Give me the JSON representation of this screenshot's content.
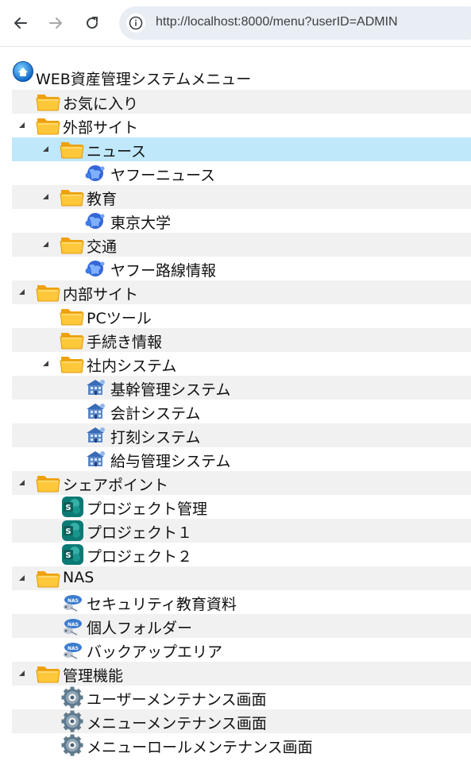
{
  "browser": {
    "url": "http://localhost:8000/menu?userID=ADMIN"
  },
  "tree": {
    "root_label": "WEB資産管理システムメニュー",
    "items": [
      {
        "label": "お気に入り",
        "icon": "folder-icon",
        "level": 1,
        "expandable": false,
        "stripe": true
      },
      {
        "label": "外部サイト",
        "icon": "folder-icon",
        "level": 1,
        "expandable": true,
        "stripe": false
      },
      {
        "label": "ニュース",
        "icon": "folder-icon",
        "level": 2,
        "expandable": true,
        "stripe": false,
        "selected": true
      },
      {
        "label": "ヤフーニュース",
        "icon": "web-globe-icon",
        "level": 3,
        "expandable": false,
        "stripe": false
      },
      {
        "label": "教育",
        "icon": "folder-icon",
        "level": 2,
        "expandable": true,
        "stripe": true
      },
      {
        "label": "東京大学",
        "icon": "web-globe-icon",
        "level": 3,
        "expandable": false,
        "stripe": false
      },
      {
        "label": "交通",
        "icon": "folder-icon",
        "level": 2,
        "expandable": true,
        "stripe": true
      },
      {
        "label": "ヤフー路線情報",
        "icon": "web-globe-icon",
        "level": 3,
        "expandable": false,
        "stripe": false
      },
      {
        "label": "内部サイト",
        "icon": "folder-icon",
        "level": 1,
        "expandable": true,
        "stripe": true
      },
      {
        "label": "PCツール",
        "icon": "folder-icon",
        "level": 2,
        "expandable": false,
        "stripe": false
      },
      {
        "label": "手続き情報",
        "icon": "folder-icon",
        "level": 2,
        "expandable": false,
        "stripe": true
      },
      {
        "label": "社内システム",
        "icon": "folder-icon",
        "level": 2,
        "expandable": true,
        "stripe": false
      },
      {
        "label": "基幹管理システム",
        "icon": "internal-system-icon",
        "level": 3,
        "expandable": false,
        "stripe": true
      },
      {
        "label": "会計システム",
        "icon": "internal-system-icon",
        "level": 3,
        "expandable": false,
        "stripe": false
      },
      {
        "label": "打刻システム",
        "icon": "internal-system-icon",
        "level": 3,
        "expandable": false,
        "stripe": true
      },
      {
        "label": "給与管理システム",
        "icon": "internal-system-icon",
        "level": 3,
        "expandable": false,
        "stripe": false
      },
      {
        "label": "シェアポイント",
        "icon": "folder-icon",
        "level": 1,
        "expandable": true,
        "stripe": true
      },
      {
        "label": "プロジェクト管理",
        "icon": "sharepoint-icon",
        "level": 2,
        "expandable": false,
        "stripe": false
      },
      {
        "label": "プロジェクト１",
        "icon": "sharepoint-icon",
        "level": 2,
        "expandable": false,
        "stripe": true
      },
      {
        "label": "プロジェクト２",
        "icon": "sharepoint-icon",
        "level": 2,
        "expandable": false,
        "stripe": false
      },
      {
        "label": "NAS",
        "icon": "folder-icon",
        "level": 1,
        "expandable": true,
        "stripe": true
      },
      {
        "label": "セキュリティ教育資料",
        "icon": "nas-icon",
        "level": 2,
        "expandable": false,
        "stripe": false
      },
      {
        "label": "個人フォルダー",
        "icon": "nas-icon",
        "level": 2,
        "expandable": false,
        "stripe": true
      },
      {
        "label": "バックアップエリア",
        "icon": "nas-icon",
        "level": 2,
        "expandable": false,
        "stripe": false
      },
      {
        "label": "管理機能",
        "icon": "folder-icon",
        "level": 1,
        "expandable": true,
        "stripe": true
      },
      {
        "label": "ユーザーメンテナンス画面",
        "icon": "gear-icon",
        "level": 2,
        "expandable": false,
        "stripe": false
      },
      {
        "label": "メニューメンテナンス画面",
        "icon": "gear-icon",
        "level": 2,
        "expandable": false,
        "stripe": true
      },
      {
        "label": "メニューロールメンテナンス画面",
        "icon": "gear-icon",
        "level": 2,
        "expandable": false,
        "stripe": false
      }
    ]
  },
  "colors": {
    "stripe": "#f1f1f1",
    "selected": "#bfe8fb",
    "folder": "#f7b51c",
    "sharepoint": "#0b7a75"
  }
}
